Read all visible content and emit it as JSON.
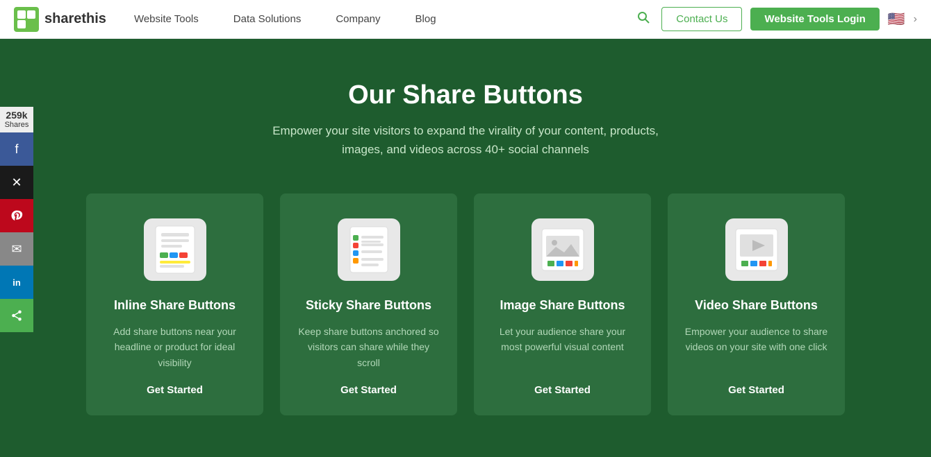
{
  "navbar": {
    "logo_text": "sharethis",
    "links": [
      {
        "label": "Website Tools",
        "id": "website-tools"
      },
      {
        "label": "Data Solutions",
        "id": "data-solutions"
      },
      {
        "label": "Company",
        "id": "company"
      },
      {
        "label": "Blog",
        "id": "blog"
      }
    ],
    "contact_label": "Contact Us",
    "login_label": "Website Tools Login"
  },
  "social_panel": {
    "count": "259k",
    "count_label": "Shares",
    "buttons": [
      {
        "id": "facebook",
        "label": "f"
      },
      {
        "id": "twitter",
        "label": "✕"
      },
      {
        "id": "pinterest",
        "label": "P"
      },
      {
        "id": "email",
        "label": "✉"
      },
      {
        "id": "linkedin",
        "label": "in"
      },
      {
        "id": "sharethis",
        "label": "✦"
      }
    ]
  },
  "hero": {
    "title": "Our Share Buttons",
    "subtitle": "Empower your site visitors to expand the virality of your content, products,\nimages, and videos across 40+ social channels"
  },
  "cards": [
    {
      "id": "inline",
      "title": "Inline Share Buttons",
      "description": "Add share buttons near your headline or product for ideal visibility",
      "cta": "Get Started"
    },
    {
      "id": "sticky",
      "title": "Sticky Share Buttons",
      "description": "Keep share buttons anchored so visitors can share while they scroll",
      "cta": "Get Started"
    },
    {
      "id": "image",
      "title": "Image Share Buttons",
      "description": "Let your audience share your most powerful visual content",
      "cta": "Get Started"
    },
    {
      "id": "video",
      "title": "Video Share Buttons",
      "description": "Empower your audience to share videos on your site with one click",
      "cta": "Get Started"
    }
  ]
}
